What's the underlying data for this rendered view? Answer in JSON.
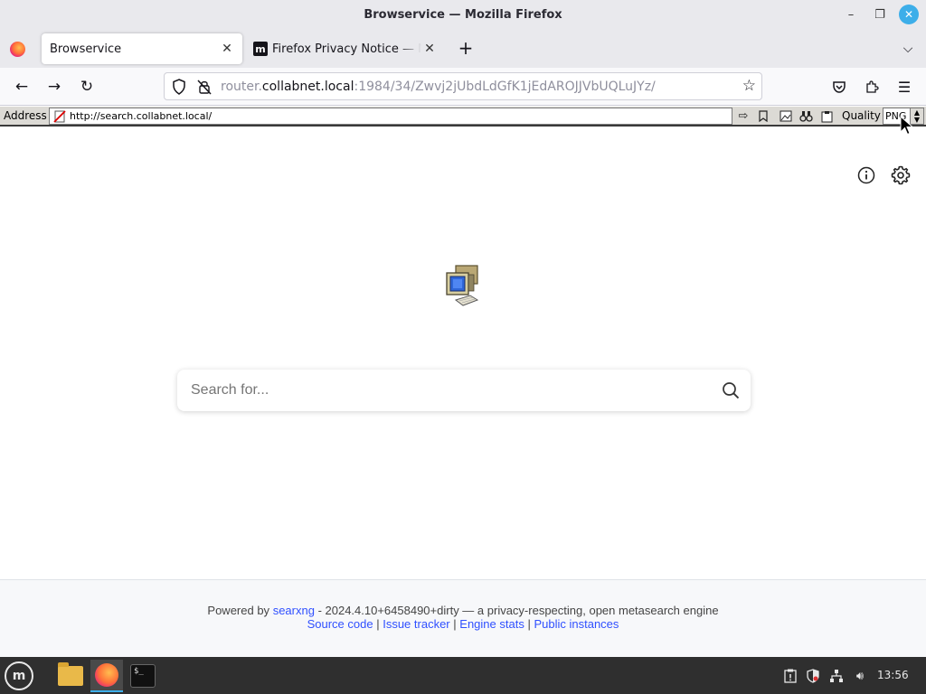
{
  "window": {
    "title": "Browservice — Mozilla Firefox"
  },
  "tabs": [
    {
      "label": "Browservice",
      "active": true
    },
    {
      "label": "Firefox Privacy Notice — Mozilla",
      "favicon": "m"
    }
  ],
  "navbar": {
    "url_prefix": "router.",
    "url_host": "collabnet.local",
    "url_rest": ":1984/34/Zwvj2jUbdLdGfK1jEdAROJJVbUQLuJYz/"
  },
  "browservice": {
    "address_label": "Address",
    "address_value": "http://search.collabnet.local/",
    "quality_label": "Quality",
    "quality_value": "PNG"
  },
  "search": {
    "placeholder": "Search for..."
  },
  "footer": {
    "powered_by": "Powered by",
    "engine_link": "searxng",
    "version_text": "- 2024.4.10+6458490+dirty — a privacy-respecting, open metasearch engine",
    "links": [
      "Source code",
      "Issue tracker",
      "Engine stats",
      "Public instances"
    ],
    "separator": "|"
  },
  "taskbar": {
    "clock": "13:56"
  },
  "colors": {
    "link": "#3050ff",
    "taskbar_bg": "#2f2f2f",
    "close_button": "#3daee9"
  }
}
